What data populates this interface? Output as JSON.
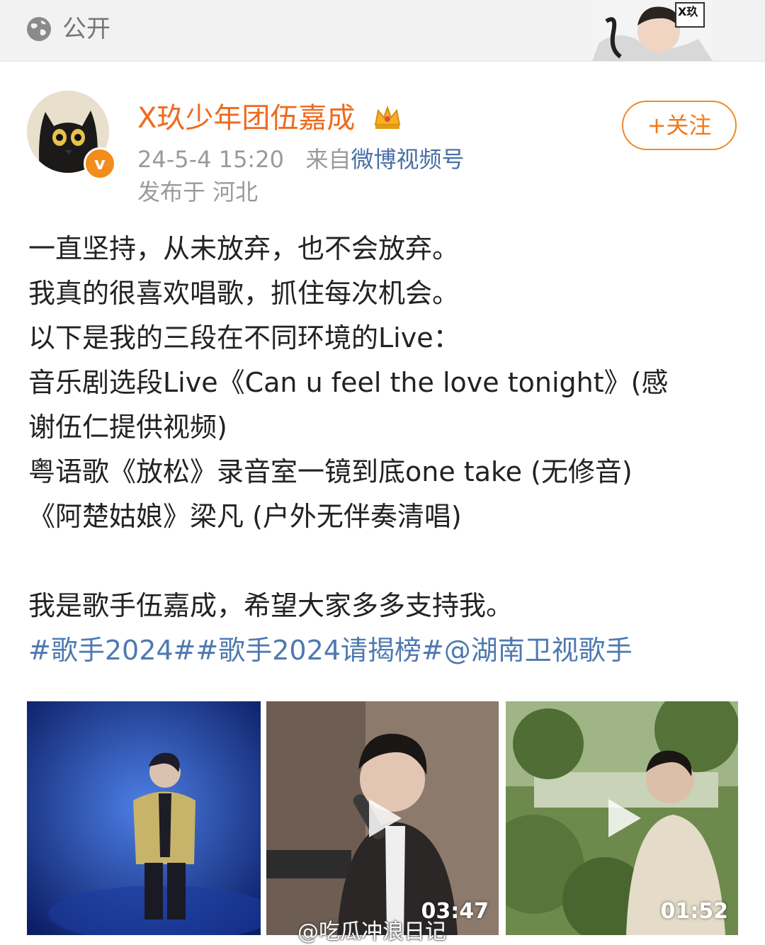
{
  "header": {
    "visibility_label": "公开",
    "globe_icon": "globe-icon"
  },
  "post": {
    "author": "X玖少年团伍嘉成",
    "timestamp": "24-5-4 15:20",
    "source_prefix": "来自",
    "source": "微博视频号",
    "location": "发布于 河北",
    "follow_label": "+关注",
    "verified_badge": "v",
    "lines": [
      "一直坚持，从未放弃，也不会放弃。",
      "我真的很喜欢唱歌，抓住每次机会。",
      "以下是我的三段在不同环境的Live：",
      "音乐剧选段Live《Can u feel the love tonight》(感",
      "谢伍仁提供视频)",
      "粤语歌《放松》录音室一镜到底one take (无修音)",
      "《阿楚姑娘》梁凡 (户外无伴奏清唱)",
      "",
      "我是歌手伍嘉成，希望大家多多支持我。"
    ],
    "tags": "#歌手2024##歌手2024请揭榜#@湖南卫视歌手"
  },
  "media": [
    {
      "duration": "",
      "kind": "image"
    },
    {
      "duration": "03:47",
      "kind": "video"
    },
    {
      "duration": "01:52",
      "kind": "video"
    }
  ],
  "watermark": "@吃瓜冲浪日记",
  "colors": {
    "author": "#f06a1d",
    "link": "#4e79b0",
    "follow": "#f08a26"
  }
}
